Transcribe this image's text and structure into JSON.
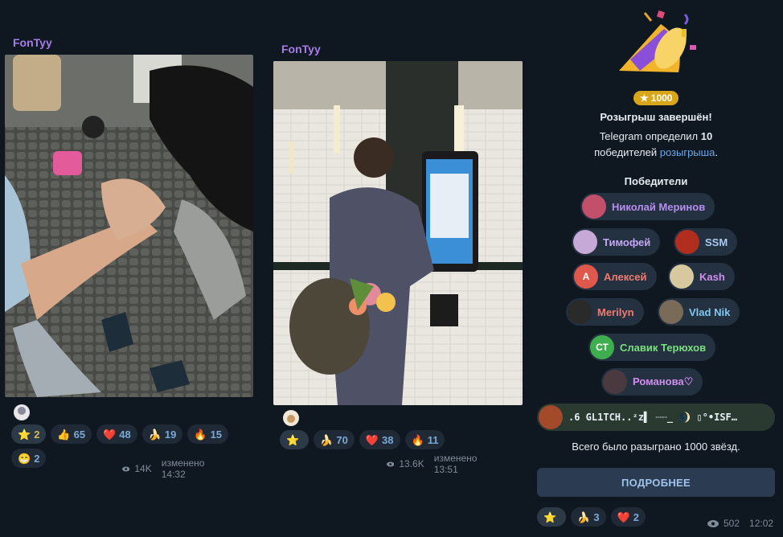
{
  "posts": [
    {
      "author": "FonTyy",
      "reactions": [
        {
          "emoji": "⭐",
          "icon": "star-icon",
          "count": "2",
          "active": true
        },
        {
          "emoji": "👍",
          "icon": "thumbs-up-icon",
          "count": "65"
        },
        {
          "emoji": "❤️",
          "icon": "heart-icon",
          "count": "48"
        },
        {
          "emoji": "🍌",
          "icon": "banana-icon",
          "count": "19"
        },
        {
          "emoji": "🔥",
          "icon": "fire-icon",
          "count": "15"
        },
        {
          "emoji": "😁",
          "icon": "grin-icon",
          "count": "2"
        }
      ],
      "views": "14K",
      "edited": "изменено 14:32"
    },
    {
      "author": "FonTyy",
      "reactions": [
        {
          "emoji": "⭐",
          "icon": "star-icon",
          "count": "",
          "active": true
        },
        {
          "emoji": "🍌",
          "icon": "banana-icon",
          "count": "70"
        },
        {
          "emoji": "❤️",
          "icon": "heart-icon",
          "count": "38"
        },
        {
          "emoji": "🔥",
          "icon": "fire-icon",
          "count": "11"
        }
      ],
      "views": "13.6K",
      "edited": "изменено 13:51"
    }
  ],
  "giveaway": {
    "badge": "1000",
    "title": "Розыгрыш завершён!",
    "body_prefix": "Telegram определил ",
    "body_count": "10",
    "body_line2_prefix": "победителей ",
    "body_link": "розыгрыша",
    "body_suffix": ".",
    "winners_title": "Победители",
    "winners": [
      {
        "name": "Николай Меринов",
        "initials": "",
        "color": "#c2506a"
      },
      {
        "name": "Тимофей",
        "initials": "",
        "color": "#c7a9d8"
      },
      {
        "name": "SSM",
        "initials": "",
        "color": "#b12d1e"
      },
      {
        "name": "Алексей",
        "initials": "А",
        "color": "#e0584c"
      },
      {
        "name": "Kash",
        "initials": "",
        "color": "#d8c8a0"
      },
      {
        "name": "Merilyn",
        "initials": "",
        "color": "#2a2a2a"
      },
      {
        "name": "Vlad Nik",
        "initials": "",
        "color": "#7a6a58"
      },
      {
        "name": "Славик Терюхов",
        "initials": "СТ",
        "color": "#3fae4f"
      },
      {
        "name": "Романова♡",
        "initials": "",
        "color": "#4a3a40"
      }
    ],
    "glitch_text": ".6 GL1TCH..ᶻz▌ ┈┈_ 🌒 ▯°•ISF…",
    "total": "Всего было разыграно 1000 звёзд.",
    "more_button": "ПОДРОБНЕЕ",
    "reactions": [
      {
        "emoji": "⭐",
        "icon": "star-icon",
        "count": "",
        "active": true
      },
      {
        "emoji": "🍌",
        "icon": "banana-icon",
        "count": "3"
      },
      {
        "emoji": "❤️",
        "icon": "heart-icon",
        "count": "2"
      }
    ],
    "views": "502",
    "time": "12:02"
  },
  "colors": {
    "background": "#0f1720",
    "author": "#a77de8",
    "chip": "#1f2a36",
    "link": "#6aa8ea",
    "button": "#2b3b52"
  }
}
